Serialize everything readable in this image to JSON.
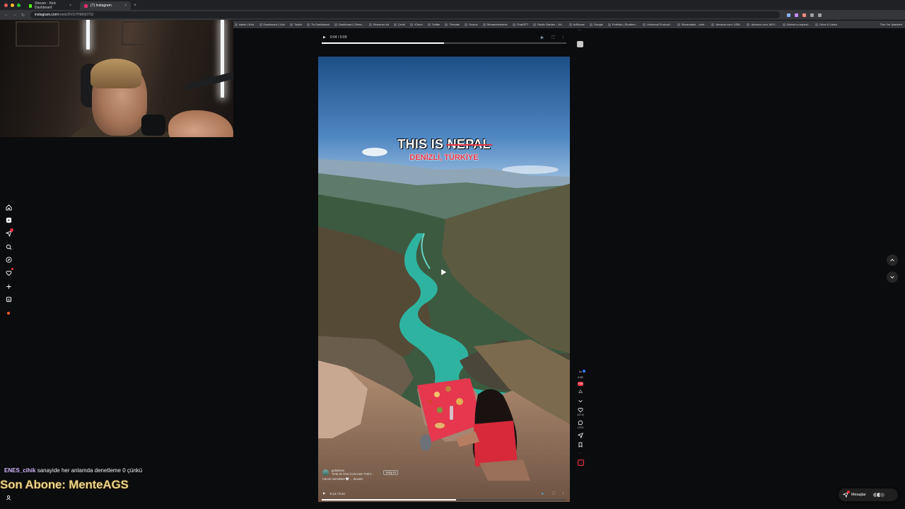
{
  "browser": {
    "tabs": [
      {
        "title": "Stream - Kick Dashboard",
        "favicon_color": "#53fc18",
        "active": false
      },
      {
        "title": "(7) Instagram",
        "favicon_color": "#e1306c",
        "active": true
      }
    ],
    "url_host": "instagram.com",
    "url_path": "/reels/DVG7HMhlOTS/",
    "bookmarks": [
      "isteler | Kick",
      "Dashboard | Kick",
      "Twitch",
      "Tw Dashboard",
      "Dashboard | Strea...",
      "Streamer Ad",
      "Çeviri",
      "iCloud",
      "Twitter",
      "Threads",
      "Oculus",
      "Streamelements",
      "ChatGPT",
      "Radio Garden – Kit...",
      "AdSense",
      "Google",
      "Portfolio | Shutters...",
      "Universal Producti...",
      "Streamable – vide...",
      "Amazon.com: USB...",
      "Amazon.com: MSY...",
      "Submit a request...",
      "Drive & Listen"
    ],
    "all_bookmarks": "Tüm Yer İşaretleri"
  },
  "chat": {
    "username": "ENES_cihik",
    "message": "sanayide her anlamda denetleme 0 çünkü"
  },
  "overlay": {
    "last_subscriber": "Son Abone: MenteAGS"
  },
  "previous_video": {
    "time": "0:04 / 0:09",
    "progress": 0.5
  },
  "reel": {
    "title_prefix": "THIS IS ",
    "title_struck": "NEPAL",
    "subtitle": "DENİZLİ, TÜRKİYE",
    "author": "gulsenem",
    "audio": "THIS IS YOU CAN ASK THEY... ",
    "follow_label": "Takip Et",
    "caption": "Canım memleket 🤍 ... devamı",
    "time": "0:13 / 0:24",
    "progress": 0.55
  },
  "rail": {
    "mini_items": [
      "Su",
      "5.3B",
      "+SH"
    ],
    "likes": "257 B",
    "comments": "1.570",
    "more": "..."
  },
  "messages": {
    "label": "Mesajlar"
  },
  "colors": {
    "instagram_red": "#e53242",
    "kick_green": "#53fc18",
    "overlay_gold": "#ecd58c"
  }
}
